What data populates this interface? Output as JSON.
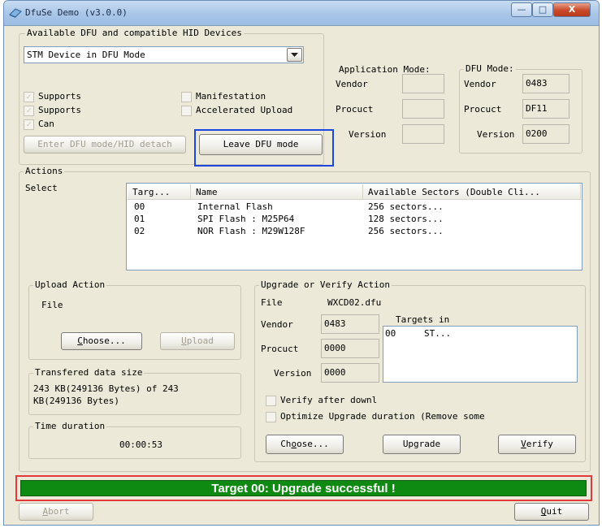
{
  "window": {
    "title": "DfuSe Demo (v3.0.0)"
  },
  "titlebar_buttons": {
    "minimize": "—",
    "maximize": "□",
    "close": "X"
  },
  "devices": {
    "group_label": "Available DFU and compatible HID Devices",
    "selected": "STM Device in DFU Mode",
    "options": [
      "STM Device in DFU Mode"
    ],
    "checkboxes": [
      {
        "label": "Supports",
        "checked": true,
        "enabled": false
      },
      {
        "label": "Supports",
        "checked": true,
        "enabled": false
      },
      {
        "label": "Can",
        "checked": true,
        "enabled": false
      },
      {
        "label": "Manifestation",
        "checked": false,
        "enabled": false
      },
      {
        "label": "Accelerated Upload",
        "checked": false,
        "enabled": false
      }
    ],
    "enter_dfu_button": "Enter DFU mode/HID detach",
    "leave_dfu_button": "Leave DFU mode"
  },
  "application_mode": {
    "label": "Application Mode:",
    "vendor_label": "Vendor",
    "vendor": "",
    "product_label": "Procuct",
    "product": "",
    "version_label": "Version",
    "version": ""
  },
  "dfu_mode": {
    "label": "DFU Mode:",
    "vendor_label": "Vendor",
    "vendor": "0483",
    "product_label": "Procuct",
    "product": "DF11",
    "version_label": "Version",
    "version": "0200"
  },
  "actions": {
    "label": "Actions",
    "select_label": "Select",
    "columns": [
      "Targ...",
      "Name",
      "Available Sectors (Double Cli..."
    ],
    "rows": [
      {
        "target": "00",
        "name": "Internal Flash",
        "sectors": "256 sectors..."
      },
      {
        "target": "01",
        "name": "SPI Flash : M25P64",
        "sectors": "128 sectors..."
      },
      {
        "target": "02",
        "name": "NOR Flash : M29W128F",
        "sectors": "256 sectors..."
      }
    ]
  },
  "upload": {
    "group_label": "Upload Action",
    "file_label": "File",
    "choose_button": "Choose...",
    "upload_button": "Upload"
  },
  "transfer": {
    "group_label": "Transfered data size",
    "text": "243 KB(249136 Bytes) of 243 KB(249136 Bytes)"
  },
  "time": {
    "group_label": "Time duration",
    "value": "00:00:53"
  },
  "upgrade": {
    "group_label": "Upgrade or Verify Action",
    "file_label": "File",
    "file_value": "WXCD02.dfu",
    "vendor_label": "Vendor",
    "vendor": "0483",
    "product_label": "Procuct",
    "product": "0000",
    "version_label": "Version",
    "version": "0000",
    "targets_label": "Targets in",
    "targets": [
      {
        "id": "00",
        "name": "ST..."
      }
    ],
    "verify_after_label": "Verify after downl",
    "optimize_label": "Optimize Upgrade duration (Remove some",
    "choose_button": "Choose...",
    "upgrade_button": "Upgrade",
    "verify_button": "Verify"
  },
  "status": {
    "text": "Target 00: Upgrade successful !",
    "color": "#0e8a12"
  },
  "footer": {
    "abort_button": "Abort",
    "quit_button": "Quit"
  }
}
